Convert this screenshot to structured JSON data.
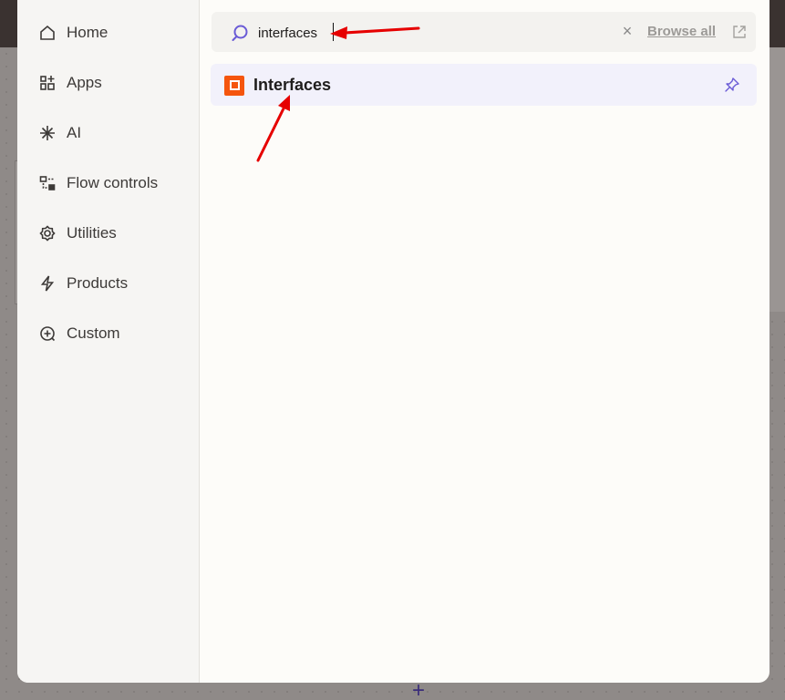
{
  "sidebar": {
    "items": [
      {
        "label": "Home",
        "icon": "home-icon"
      },
      {
        "label": "Apps",
        "icon": "apps-icon"
      },
      {
        "label": "AI",
        "icon": "ai-sparkle-icon"
      },
      {
        "label": "Flow controls",
        "icon": "flow-controls-icon"
      },
      {
        "label": "Utilities",
        "icon": "utilities-gear-icon"
      },
      {
        "label": "Products",
        "icon": "lightning-icon"
      },
      {
        "label": "Custom",
        "icon": "custom-plus-icon"
      }
    ]
  },
  "search": {
    "value": "interfaces",
    "browse_all_label": "Browse all"
  },
  "results": [
    {
      "label": "Interfaces",
      "icon": "interfaces-app-icon",
      "accent": "#f5550d"
    }
  ],
  "colors": {
    "accent": "#6a5bd6",
    "annotation_arrow": "#e60000"
  }
}
